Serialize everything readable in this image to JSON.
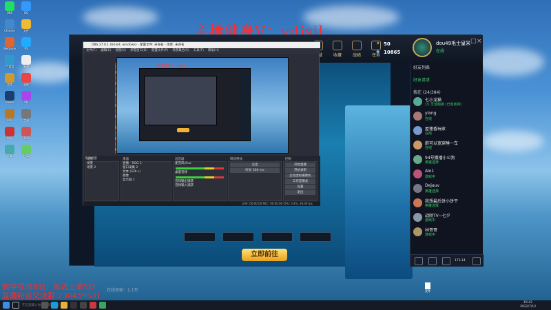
{
  "watermark": {
    "top": "主播健身V：ydjsjl",
    "bottom_line1": "教学视频B站：年迈上单YD",
    "bottom_line2": "直播粉丝交流群:230459531"
  },
  "desktop": {
    "icons": [
      "OBS",
      "Chrome",
      "WeGame",
      "YY语音",
      "游戏",
      "Steam",
      "LOL",
      "网易",
      "下载",
      "QQ",
      "文件",
      "PS",
      "新建",
      "录屏",
      "PR",
      "工具",
      "TGP",
      "工具2"
    ],
    "file_label": "文件"
  },
  "client": {
    "nav": [
      "商城",
      "收藏",
      "战绩",
      "任务"
    ],
    "gold": "50",
    "points": "10865",
    "username": "dou49毛士皇米",
    "user_status": "在线",
    "window_buttons": [
      "—",
      "□",
      "×"
    ],
    "start_button": "立即前往",
    "close_icon": "×",
    "stats_text": "在线玩家：1.1万",
    "bottom_right_count": "173.14"
  },
  "friends": {
    "header": "好友列表",
    "tab": "好友请求",
    "group": "我在 (24/384)",
    "list": [
      {
        "name": "七小龙猫",
        "status": "15 灵活组排 (已有房间)",
        "color": "#5a9"
      },
      {
        "name": "ylong",
        "status": "在线",
        "color": "#a77"
      },
      {
        "name": "屋蓬香玩家",
        "status": "在线",
        "color": "#79c"
      },
      {
        "name": "蔚可以宽穿睡一车",
        "status": "在线",
        "color": "#c96"
      },
      {
        "name": "94号撒播小公狗",
        "status": "英雄选择",
        "color": "#6a8"
      },
      {
        "name": "Alo1",
        "status": "游戏中",
        "color": "#b57"
      },
      {
        "name": "Dejauv",
        "status": "英雄选择",
        "color": "#778"
      },
      {
        "name": "我想最后饼小饼干",
        "status": "英雄选择",
        "color": "#c75"
      },
      {
        "name": "战刚TV~七夕",
        "status": "游戏中",
        "color": "#89a"
      },
      {
        "name": "林哥哥",
        "status": "游戏中",
        "color": "#a96"
      }
    ]
  },
  "obs": {
    "title": "OBS 27.0.1 (64-bit, windows) - 配置文件: 未命名 - 场景: 未命名",
    "menu": [
      "文件(F)",
      "编辑(E)",
      "视图(V)",
      "停靠窗口(D)",
      "配置文件(P)",
      "场景集合(S)",
      "工具(T)",
      "帮助(H)"
    ],
    "preview_label": "主播健身V：ydjsjl",
    "scene_label": "来源场景",
    "docks": {
      "scenes": {
        "header": "场景",
        "items": [
          "场景",
          "场景 2"
        ]
      },
      "sources": {
        "header": "来源",
        "items": [
          "直播 - ROG 1",
          "窗口采集 2",
          "文本 (GDI+)",
          "图像",
          "显示器 1"
        ]
      },
      "mixer": {
        "header": "混音器",
        "items": [
          "麦克风/Aux",
          "桌面音频",
          "音频输出捕获",
          "音频输入捕获"
        ]
      },
      "transitions": {
        "header": "转场特效",
        "items": [
          "淡出",
          "时长 300 ms"
        ]
      },
      "controls": {
        "header": "控制",
        "items": [
          "开始直播",
          "开始录制",
          "启动虚拟摄像机",
          "工作室模式",
          "设置",
          "退出"
        ]
      }
    },
    "status": "LIVE: 00:00:00  REC: 00:00:00  CPU: 3.4%, 30.00 fps"
  },
  "taskbar": {
    "time": "19:42",
    "date": "2022/7/12",
    "search": "在这里输入你要搜索的内容"
  }
}
